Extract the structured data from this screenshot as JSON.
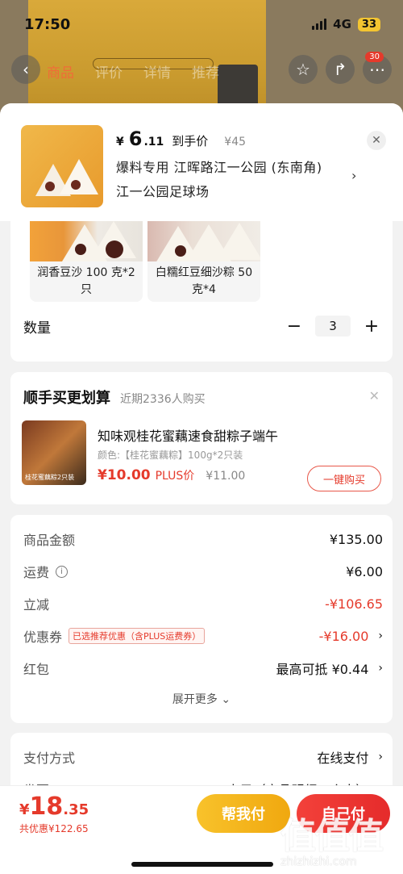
{
  "status_bar": {
    "time": "17:50",
    "network": "4G",
    "battery": "33"
  },
  "nav": {
    "tabs": [
      "商品",
      "评价",
      "详情",
      "推荐"
    ],
    "cart_count": "30"
  },
  "sheet_header": {
    "price_symbol": "¥",
    "price_int": "6",
    "price_dec": ".11",
    "price_label": "到手价",
    "original_price": "¥45",
    "address_line1": "爆料专用  江晖路江一公园 (东南角)",
    "address_line2": "江一公园足球场"
  },
  "variants": [
    {
      "name": "润香豆沙 100 克*2只"
    },
    {
      "name": "白糯红豆细沙粽 50 克*4"
    }
  ],
  "quantity": {
    "label": "数量",
    "minus": "−",
    "value": "3",
    "plus": "+"
  },
  "upsell": {
    "title": "顺手买更划算",
    "subtitle": "近期2336人购买",
    "product_name": "知味观桂花蜜藕速食甜粽子端午",
    "spec": "颜色:【桂花蜜藕粽】100g*2只装",
    "price": "¥10.00",
    "plus_label": "PLUS价",
    "original_price": "¥11.00",
    "buy_label": "一键购买",
    "thumb_text": "桂花蜜藕粽2只装"
  },
  "summary": {
    "goods_amount_label": "商品金额",
    "goods_amount": "¥135.00",
    "shipping_label": "运费",
    "shipping": "¥6.00",
    "discount_label": "立减",
    "discount": "-¥106.65",
    "coupon_label": "优惠券",
    "coupon_tag": "已选推荐优惠（含PLUS运费券）",
    "coupon": "-¥16.00",
    "redpacket_label": "红包",
    "redpacket": "最高可抵 ¥0.44",
    "expand_label": "展开更多"
  },
  "payment": {
    "method_label": "支付方式",
    "method_value": "在线支付",
    "invoice_label": "发票",
    "invoice_value": "电子（商品明细 - 个人）"
  },
  "bottom": {
    "total_yen": "¥",
    "total_int": "18",
    "total_dec": ".35",
    "total_save": "共优惠¥122.65",
    "help_pay": "帮我付",
    "self_pay": "自己付"
  },
  "watermark": {
    "logo": "值值值",
    "url": "zhizhizhi.com"
  },
  "colors": {
    "accent_red": "#e53a2b",
    "help_yellow": "#f8c22b",
    "sheet_bg": "#f2f2f2"
  }
}
